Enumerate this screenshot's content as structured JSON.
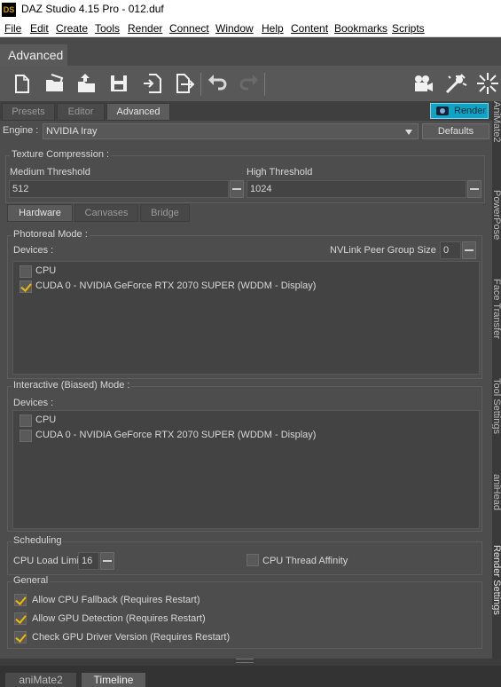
{
  "window": {
    "title": "DAZ Studio 4.15 Pro - 012.duf",
    "logo_text": "DS"
  },
  "menu": [
    "File",
    "Edit",
    "Create",
    "Tools",
    "Render",
    "Connect",
    "Window",
    "Help",
    "Content",
    "Bookmarks",
    "Scripts"
  ],
  "layout_tab": "Advanced",
  "toolbar": {
    "icons": [
      "new-file-icon",
      "open-folder-icon",
      "merge-icon",
      "save-icon",
      "import-icon",
      "export-icon",
      "undo-icon",
      "redo-icon",
      "render-camera-icon",
      "spotlight-icon",
      "light-burst-icon"
    ]
  },
  "pane_tabs": [
    {
      "label": "Presets",
      "active": false
    },
    {
      "label": "Editor",
      "active": false
    },
    {
      "label": "Advanced",
      "active": true
    }
  ],
  "render_button": "Render",
  "engine": {
    "label": "Engine :",
    "value": "NVIDIA Iray",
    "defaults_label": "Defaults"
  },
  "texture_compression": {
    "title": "Texture Compression :",
    "medium_label": "Medium Threshold",
    "medium_value": "512",
    "high_label": "High Threshold",
    "high_value": "1024"
  },
  "hw_tabs": [
    {
      "label": "Hardware",
      "active": true
    },
    {
      "label": "Canvases",
      "active": false
    },
    {
      "label": "Bridge",
      "active": false
    }
  ],
  "photoreal": {
    "title": "Photoreal Mode :",
    "devices_label": "Devices :",
    "nvlink_label": "NVLink Peer Group Size :",
    "nvlink_value": "0",
    "devices": [
      {
        "label": "CPU",
        "checked": false
      },
      {
        "label": "CUDA 0 - NVIDIA GeForce RTX 2070 SUPER (WDDM - Display)",
        "checked": true
      }
    ]
  },
  "interactive": {
    "title": "Interactive (Biased) Mode :",
    "devices_label": "Devices :",
    "devices": [
      {
        "label": "CPU",
        "checked": false
      },
      {
        "label": "CUDA 0 - NVIDIA GeForce RTX 2070 SUPER (WDDM - Display)",
        "checked": false
      }
    ]
  },
  "scheduling": {
    "title": "Scheduling",
    "cpu_load_label": "CPU Load Limit",
    "cpu_load_value": "16",
    "affinity_label": "CPU Thread Affinity",
    "affinity_checked": false
  },
  "general": {
    "title": "General",
    "options": [
      {
        "label": "Allow CPU Fallback (Requires Restart)",
        "checked": true
      },
      {
        "label": "Allow GPU Detection (Requires Restart)",
        "checked": true
      },
      {
        "label": "Check GPU Driver Version (Requires Restart)",
        "checked": true
      }
    ]
  },
  "sidebar_tabs": [
    "AniMate2",
    "PowerPose",
    "Face Transfer",
    "Tool Settings",
    "aniHead",
    "Render Settings"
  ],
  "bottom_tabs": [
    {
      "label": "aniMate2",
      "active": false
    },
    {
      "label": "Timeline",
      "active": true
    }
  ]
}
